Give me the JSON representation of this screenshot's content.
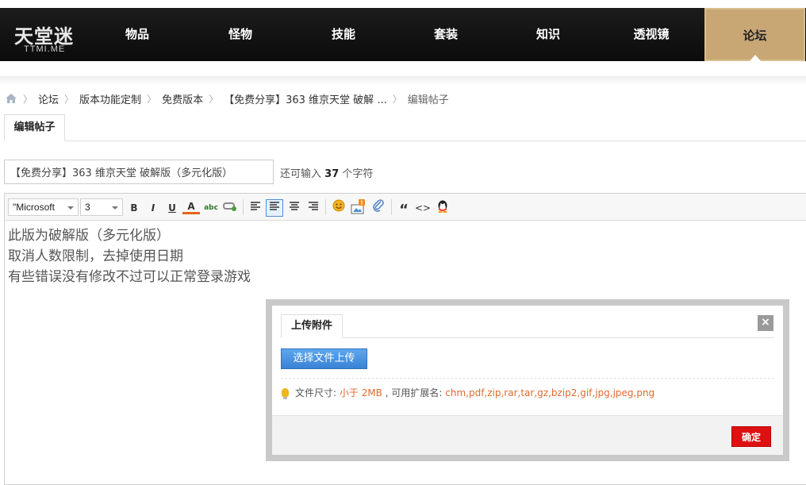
{
  "header": {
    "logo_main": "天堂迷",
    "logo_sub": "TTMI.ME",
    "nav": [
      "物品",
      "怪物",
      "技能",
      "套装",
      "知识",
      "透视镜",
      "论坛"
    ],
    "active_nav": "论坛",
    "accent_color": "#c8a775"
  },
  "breadcrumb": {
    "home_icon": "home-icon",
    "items": [
      "论坛",
      "版本功能定制",
      "免费版本",
      "【免费分享】363 维京天堂 破解 ...",
      "编辑帖子"
    ]
  },
  "tabs": {
    "edit_post": "编辑帖子"
  },
  "title_field": {
    "value": "【免费分享】363 维京天堂 破解版（多元化版）",
    "hint_prefix": "还可输入",
    "hint_count": "37",
    "hint_suffix": "个字符"
  },
  "toolbar": {
    "font_family": "\"Microsoft",
    "font_size": "3",
    "bold": "B",
    "italic": "I",
    "underline": "U",
    "font_color": "A",
    "spellcheck": "abc",
    "quote": "“",
    "code": "<>",
    "upload_badge": "!"
  },
  "content": {
    "lines": [
      "此版为破解版（多元化版）",
      "取消人数限制，去掉使用日期",
      "有些错误没有修改不过可以正常登录游戏"
    ]
  },
  "dialog": {
    "tab_label": "上传附件",
    "close_label": "×",
    "upload_button": "选择文件上传",
    "info_label": "文件尺寸:",
    "size_limit": "小于 2MB",
    "ext_label": ", 可用扩展名:",
    "extensions": "chm,pdf,zip,rar,tar,gz,bzip2,gif,jpg,jpeg,png",
    "confirm_button": "确定"
  }
}
